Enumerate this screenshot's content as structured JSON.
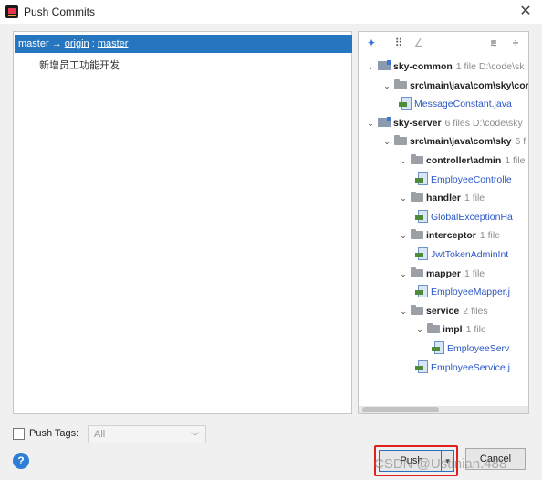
{
  "window": {
    "title": "Push Commits",
    "close_glyph": "✕"
  },
  "branch": {
    "local": "master",
    "arrow": "→",
    "remote": "origin",
    "separator": ":",
    "remote_branch": "master"
  },
  "commits": [
    {
      "message": "新增员工功能开发"
    }
  ],
  "toolbar": [
    {
      "name": "expand-arrows-icon",
      "glyph": "✦"
    },
    {
      "name": "group-by-icon",
      "glyph": "⠿"
    },
    {
      "name": "edit-icon",
      "glyph": "∠"
    },
    {
      "name": "expand-all-icon",
      "glyph": "⩳"
    },
    {
      "name": "collapse-all-icon",
      "glyph": "÷"
    }
  ],
  "tree": [
    {
      "id": "n0",
      "depth": 0,
      "type": "module",
      "label": "sky-common",
      "meta": "1 file D:\\code\\sk"
    },
    {
      "id": "n1",
      "depth": 1,
      "type": "folder",
      "label": "src\\main\\java\\com\\sky\\cor",
      "meta": ""
    },
    {
      "id": "n2",
      "depth": 2,
      "type": "file",
      "label": "MessageConstant.java",
      "meta": ""
    },
    {
      "id": "n3",
      "depth": 0,
      "type": "module",
      "label": "sky-server",
      "meta": "6 files D:\\code\\sky"
    },
    {
      "id": "n4",
      "depth": 1,
      "type": "folder",
      "label": "src\\main\\java\\com\\sky",
      "meta": "6 f"
    },
    {
      "id": "n5",
      "depth": 2,
      "type": "folder",
      "label": "controller\\admin",
      "meta": "1 file"
    },
    {
      "id": "n6",
      "depth": 3,
      "type": "file",
      "label": "EmployeeControlle",
      "meta": ""
    },
    {
      "id": "n7",
      "depth": 2,
      "type": "folder",
      "label": "handler",
      "meta": "1 file"
    },
    {
      "id": "n8",
      "depth": 3,
      "type": "file",
      "label": "GlobalExceptionHa",
      "meta": ""
    },
    {
      "id": "n9",
      "depth": 2,
      "type": "folder",
      "label": "interceptor",
      "meta": "1 file"
    },
    {
      "id": "n10",
      "depth": 3,
      "type": "file",
      "label": "JwtTokenAdminInt",
      "meta": ""
    },
    {
      "id": "n11",
      "depth": 2,
      "type": "folder",
      "label": "mapper",
      "meta": "1 file"
    },
    {
      "id": "n12",
      "depth": 3,
      "type": "file",
      "label": "EmployeeMapper.j",
      "meta": ""
    },
    {
      "id": "n13",
      "depth": 2,
      "type": "folder",
      "label": "service",
      "meta": "2 files"
    },
    {
      "id": "n14",
      "depth": 3,
      "type": "folder",
      "label": "impl",
      "meta": "1 file"
    },
    {
      "id": "n15",
      "depth": 4,
      "type": "file",
      "label": "EmployeeServ",
      "meta": ""
    },
    {
      "id": "n16",
      "depth": 3,
      "type": "file",
      "label": "EmployeeService.j",
      "meta": ""
    }
  ],
  "push_tags": {
    "label": "Push Tags:",
    "select_value": "All"
  },
  "buttons": {
    "push": "Push",
    "cancel": "Cancel",
    "help": "?"
  },
  "watermark": "CSDN @Ustinian.488",
  "colors": {
    "selection": "#2675bf",
    "file_blue": "#2b57c6",
    "highlight": "#e02020"
  }
}
